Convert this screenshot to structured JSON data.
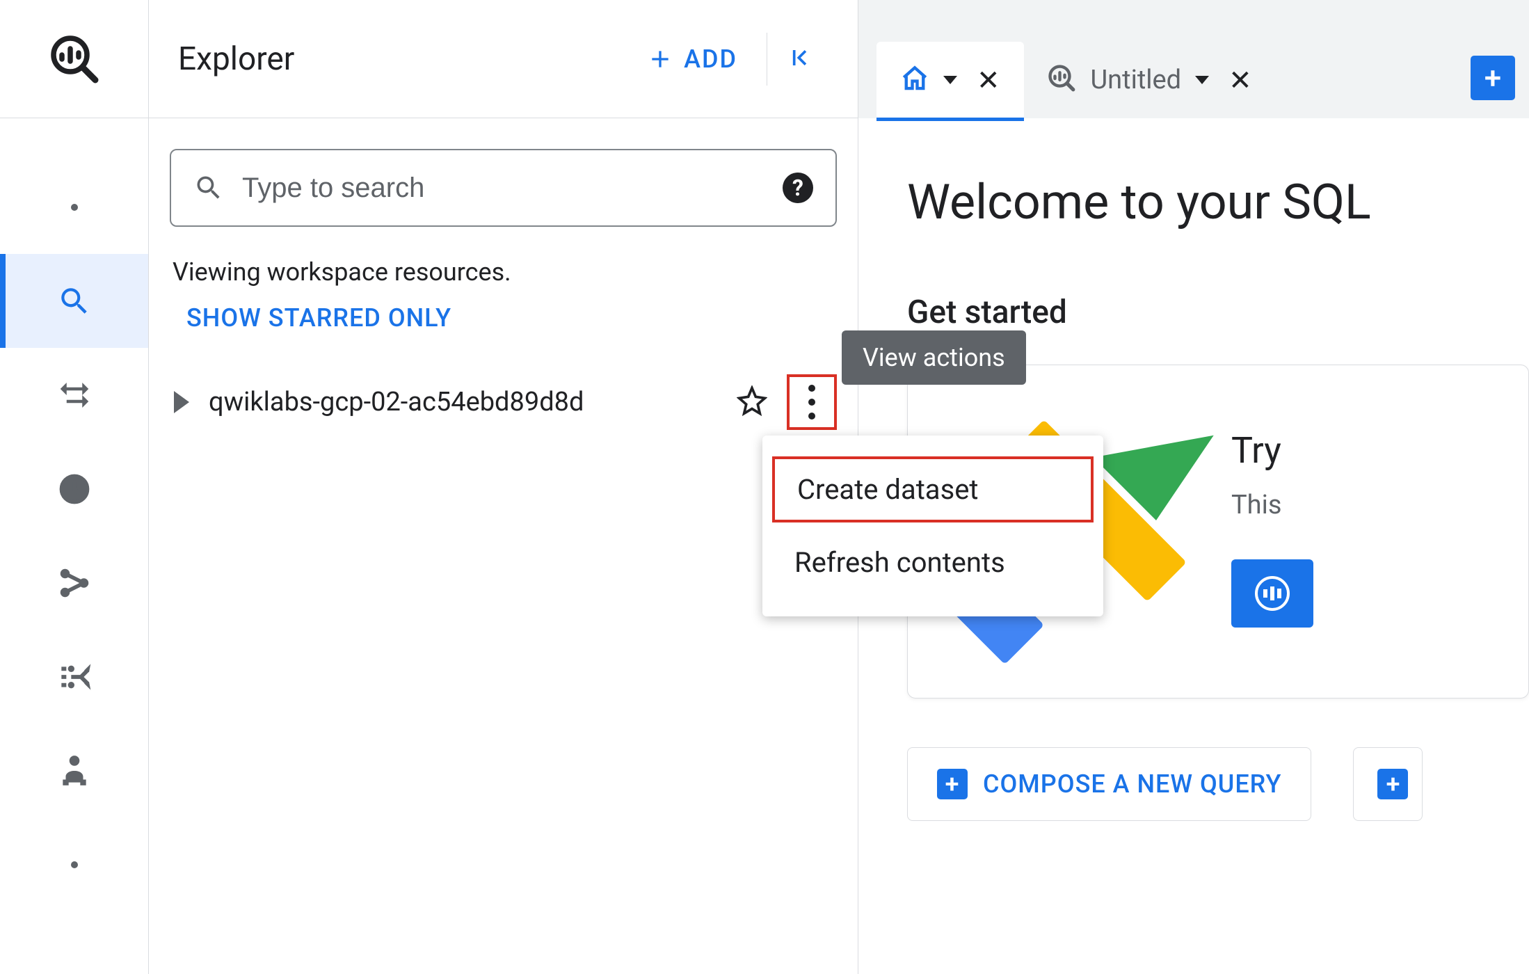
{
  "nav_rail": {
    "icons": [
      "dot",
      "search",
      "transfer",
      "clock",
      "branch",
      "pipeline",
      "capacity",
      "dot"
    ]
  },
  "explorer": {
    "title": "Explorer",
    "add_label": "ADD",
    "search_placeholder": "Type to search",
    "resources_text": "Viewing workspace resources.",
    "show_starred_label": "SHOW STARRED ONLY",
    "project_name": "qwiklabs-gcp-02-ac54ebd89d8d",
    "tooltip": "View actions",
    "menu": {
      "create_dataset": "Create dataset",
      "refresh_contents": "Refresh contents"
    }
  },
  "tabs": {
    "untitled_label": "Untitled"
  },
  "main": {
    "welcome_title": "Welcome to your SQL",
    "get_started": "Get started",
    "card_title": "Try",
    "card_sub": "This",
    "compose_label": "COMPOSE A NEW QUERY"
  }
}
